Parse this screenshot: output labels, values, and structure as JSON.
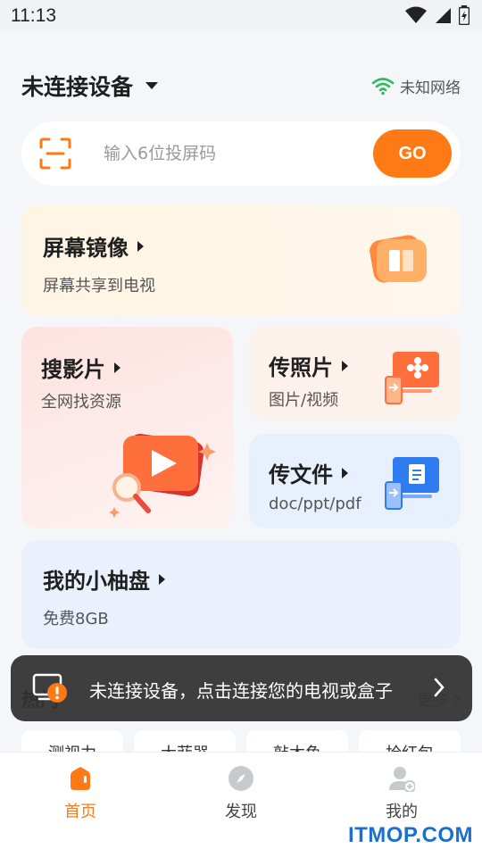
{
  "status_bar": {
    "time": "11:13",
    "icons": [
      "wifi-icon",
      "signal-icon",
      "battery-icon"
    ]
  },
  "header": {
    "device_title": "未连接设备",
    "network_label": "未知网络"
  },
  "search": {
    "placeholder": "输入6位投屏码",
    "go_label": "GO"
  },
  "cards": {
    "mirror": {
      "title": "屏幕镜像",
      "subtitle": "屏幕共享到电视"
    },
    "search_movie": {
      "title": "搜影片",
      "subtitle": "全网找资源"
    },
    "photo": {
      "title": "传照片",
      "subtitle": "图片/视频"
    },
    "file": {
      "title": "传文件",
      "subtitle": "doc/ppt/pdf"
    },
    "disk": {
      "title": "我的小柚盘",
      "subtitle": "免费8GB"
    }
  },
  "hot": {
    "title": "热门",
    "more_label": "更多"
  },
  "chips": [
    "测视力",
    "大菲器",
    "敲木鱼",
    "抢红包"
  ],
  "toast": {
    "message": "未连接设备，点击连接您的电视或盒子"
  },
  "tabs": [
    {
      "label": "首页",
      "icon": "home-icon",
      "active": true
    },
    {
      "label": "发现",
      "icon": "discover-icon",
      "active": false
    },
    {
      "label": "我的",
      "icon": "profile-icon",
      "active": false
    }
  ],
  "watermark": "ITMOP.COM",
  "colors": {
    "accent": "#ff7a14",
    "wifi_green": "#2dbb5c",
    "file_blue": "#2f7bf0"
  }
}
